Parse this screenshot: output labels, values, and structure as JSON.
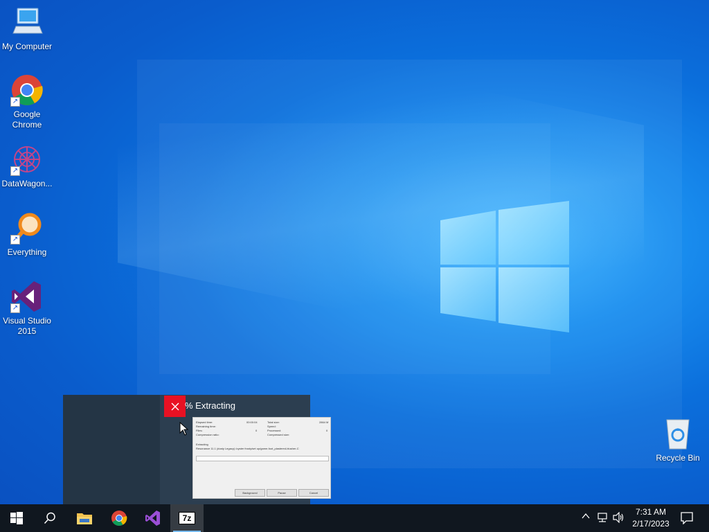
{
  "desktop": {
    "icons": [
      {
        "label": "My Computer",
        "icon": "computer-icon"
      },
      {
        "label": "Google\nChrome",
        "icon": "chrome-icon"
      },
      {
        "label": "DataWagon...",
        "icon": "datawagon-icon"
      },
      {
        "label": "Everything",
        "icon": "everything-icon"
      },
      {
        "label": "Visual Studio\n2015",
        "icon": "visual-studio-icon"
      },
      {
        "label": "Recycle Bin",
        "icon": "recycle-bin-icon"
      }
    ]
  },
  "preview": {
    "title": "% Extracting",
    "close_icon": "close-icon",
    "thumb": {
      "elapsed_label": "Elapsed time:",
      "elapsed_value": "00:00:04",
      "remaining_label": "Remaining time:",
      "files_label": "Files:",
      "files_value": "0",
      "ratio_label": "Compression ratio:",
      "total_label": "Total size:",
      "total_value": "2864 M",
      "speed_label": "Speed:",
      "processed_label": "Processed:",
      "processed_value": "0",
      "compressed_label": "Compressed size:",
      "extracting_label": "Extracting",
      "path": "Resonance 11.1 (dusty Legacy) /oyster frosty/set up/game-foot_plastered-blusher-C",
      "buttons": [
        "Background",
        "Pause",
        "Cancel"
      ]
    }
  },
  "taskbar": {
    "items": [
      {
        "name": "start",
        "icon": "windows-start-icon"
      },
      {
        "name": "search",
        "icon": "search-icon"
      },
      {
        "name": "file-explorer",
        "icon": "folder-icon"
      },
      {
        "name": "chrome",
        "icon": "chrome-icon"
      },
      {
        "name": "visual-studio",
        "icon": "visual-studio-icon"
      },
      {
        "name": "7zip",
        "icon": "7zip-icon",
        "label": "7z",
        "active": true
      }
    ],
    "tray": {
      "time": "7:31 AM",
      "date": "2/17/2023"
    }
  },
  "colors": {
    "accent": "#0a6fdc",
    "close_red": "#e81123",
    "taskbar": "#10171f"
  }
}
